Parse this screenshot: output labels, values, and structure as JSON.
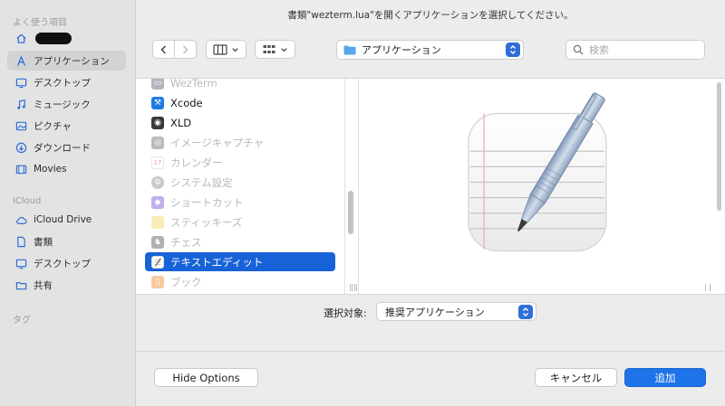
{
  "window": {
    "title": "書類\"wezterm.lua\"を開くアプリケーションを選択してください。"
  },
  "sidebar": {
    "favorites_header": "よく使う項目",
    "favorites": [
      {
        "label": "",
        "icon": "home-icon"
      },
      {
        "label": "アプリケーション",
        "icon": "applications-icon"
      },
      {
        "label": "デスクトップ",
        "icon": "desktop-icon"
      },
      {
        "label": "ミュージック",
        "icon": "music-icon"
      },
      {
        "label": "ピクチャ",
        "icon": "pictures-icon"
      },
      {
        "label": "ダウンロード",
        "icon": "downloads-icon"
      },
      {
        "label": "Movies",
        "icon": "movies-icon"
      }
    ],
    "icloud_header": "iCloud",
    "icloud": [
      {
        "label": "iCloud Drive",
        "icon": "cloud-icon"
      },
      {
        "label": "書類",
        "icon": "document-icon"
      },
      {
        "label": "デスクトップ",
        "icon": "desktop-icon"
      },
      {
        "label": "共有",
        "icon": "shared-folder-icon"
      }
    ],
    "tags_header": "タグ"
  },
  "toolbar": {
    "location": "アプリケーション",
    "search_placeholder": "検索"
  },
  "browser": {
    "apps": [
      {
        "label": "WezTerm",
        "state": "dim"
      },
      {
        "label": "Xcode",
        "state": "normal"
      },
      {
        "label": "XLD",
        "state": "normal"
      },
      {
        "label": "イメージキャプチャ",
        "state": "dim"
      },
      {
        "label": "カレンダー",
        "state": "dim"
      },
      {
        "label": "システム設定",
        "state": "dim"
      },
      {
        "label": "ショートカット",
        "state": "dim"
      },
      {
        "label": "スティッキーズ",
        "state": "dim"
      },
      {
        "label": "チェス",
        "state": "dim"
      },
      {
        "label": "テキストエディット",
        "state": "selected"
      },
      {
        "label": "ブック",
        "state": "dim"
      }
    ]
  },
  "enable": {
    "label": "選択対象:",
    "value": "推奨アプリケーション"
  },
  "footer": {
    "hide_options": "Hide Options",
    "cancel": "キャンセル",
    "add": "追加"
  },
  "colors": {
    "accent": "#1f73e8",
    "selection": "#1862d8"
  }
}
